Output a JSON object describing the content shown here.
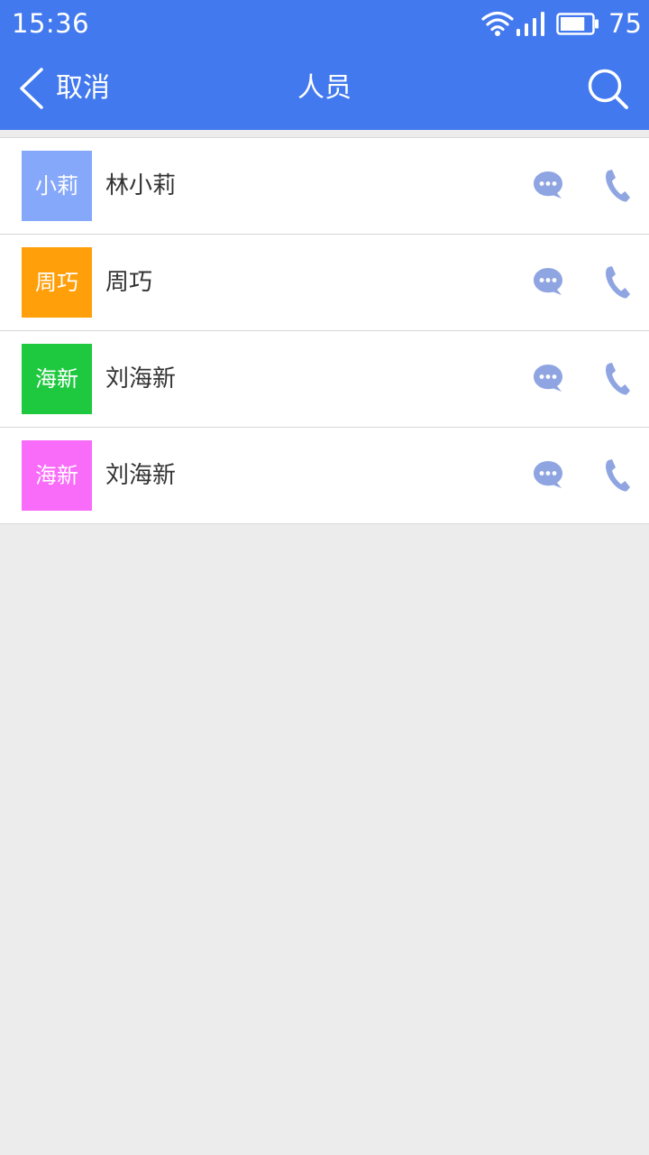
{
  "status_bar": {
    "time": "15:36",
    "battery_level": "75",
    "icons": [
      "wifi-icon",
      "signal-icon",
      "battery-icon"
    ]
  },
  "nav": {
    "back_label": "取消",
    "title": "人员",
    "icons": [
      "back-chevron-icon",
      "search-icon"
    ]
  },
  "colors": {
    "header": "#4279ee",
    "background": "#ececec",
    "action_icon": "#8fa5e2"
  },
  "contacts": [
    {
      "avatar_text": "小莉",
      "name": "林小莉",
      "avatar_color": "#86a8fb"
    },
    {
      "avatar_text": "周巧",
      "name": "周巧",
      "avatar_color": "#ff9f0a"
    },
    {
      "avatar_text": "海新",
      "name": "刘海新",
      "avatar_color": "#1fc93f"
    },
    {
      "avatar_text": "海新",
      "name": "刘海新",
      "avatar_color": "#f96bf9"
    }
  ],
  "row_actions": {
    "icons": [
      "chat-bubble-icon",
      "phone-icon"
    ]
  }
}
